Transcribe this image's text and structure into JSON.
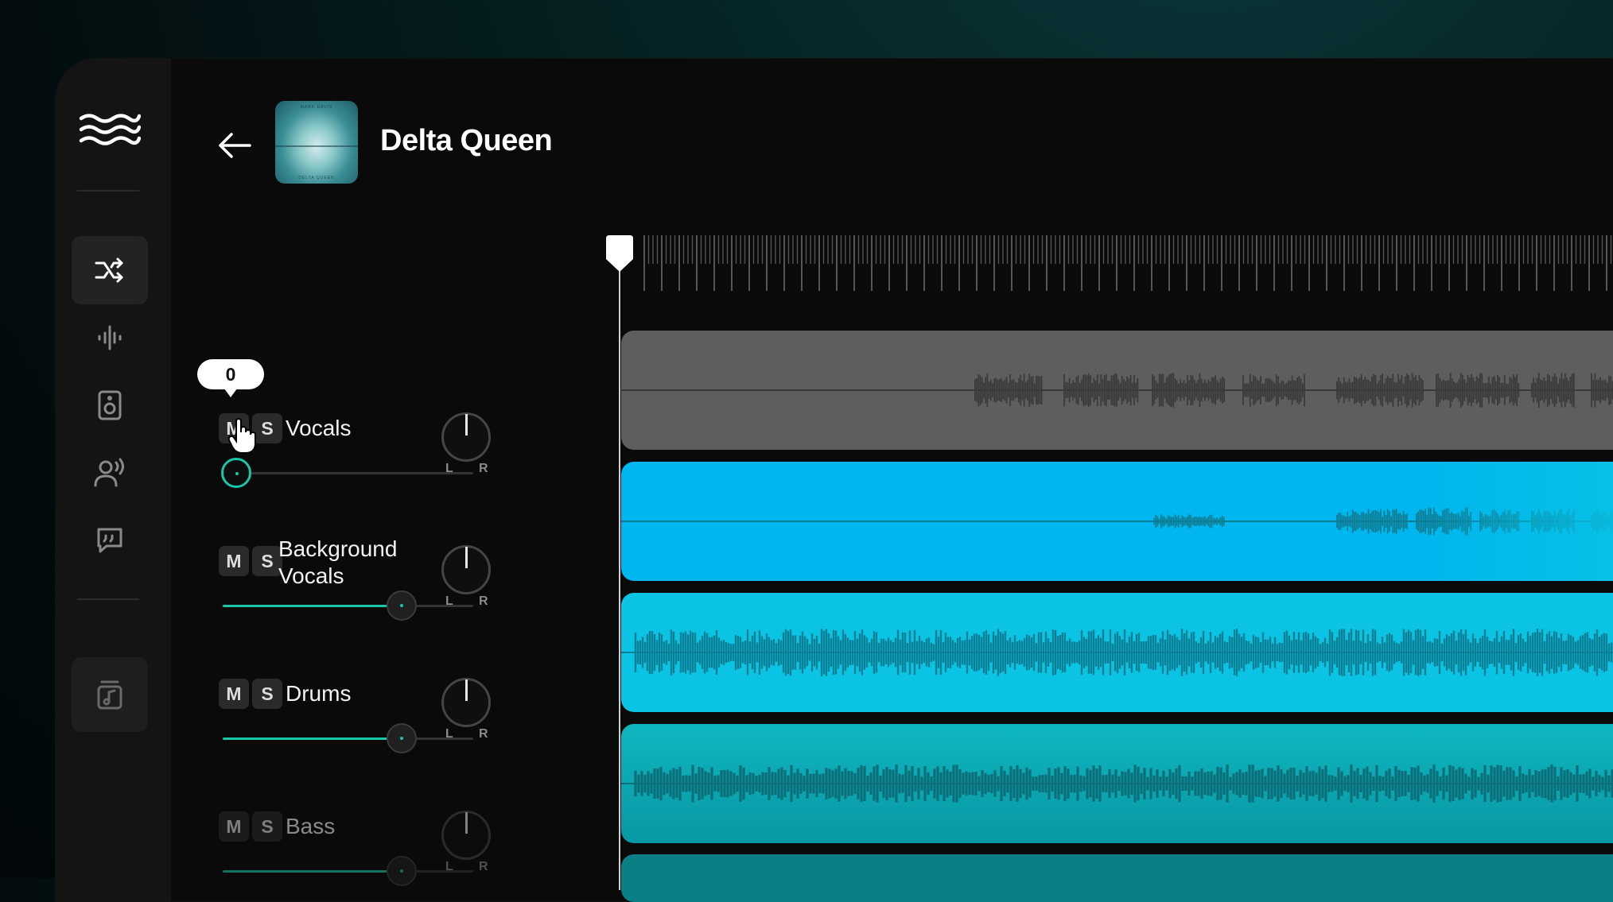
{
  "song": {
    "title": "Delta Queen",
    "cover_top_text": "MARK DAVIS",
    "cover_bottom_text": "DELTA QUEEN"
  },
  "sidebar": {
    "items": [
      {
        "name": "shuffle",
        "active": true
      },
      {
        "name": "waveform",
        "active": false
      },
      {
        "name": "speaker",
        "active": false
      },
      {
        "name": "voice",
        "active": false
      },
      {
        "name": "lyrics",
        "active": false
      },
      {
        "name": "music-library",
        "active": false
      }
    ]
  },
  "tracks": [
    {
      "name": "Vocals",
      "mute_label": "M",
      "solo_label": "S",
      "volume": 0,
      "tooltip": "0",
      "pan_left": "L",
      "pan_right": "R",
      "color": "#5a5a5a"
    },
    {
      "name": "Background Vocals",
      "mute_label": "M",
      "solo_label": "S",
      "volume": 0.72,
      "pan_left": "L",
      "pan_right": "R",
      "color": "#00b5ec"
    },
    {
      "name": "Drums",
      "mute_label": "M",
      "solo_label": "S",
      "volume": 0.72,
      "pan_left": "L",
      "pan_right": "R",
      "color": "#09c0df"
    },
    {
      "name": "Bass",
      "mute_label": "M",
      "solo_label": "S",
      "volume": 0.72,
      "pan_left": "L",
      "pan_right": "R",
      "color": "#0aa9b2"
    }
  ],
  "colors": {
    "accent": "#19c6a8",
    "background": "#0a0a0a",
    "sidebar": "#141414"
  }
}
